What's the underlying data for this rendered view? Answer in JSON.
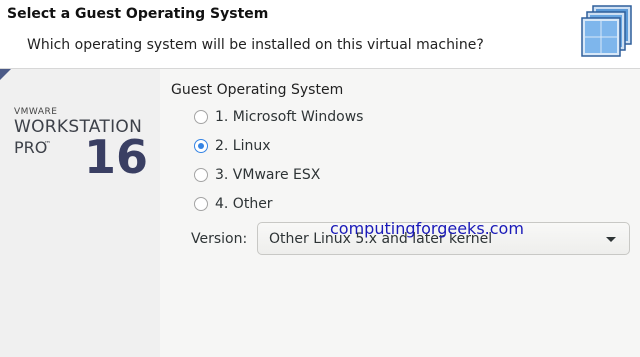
{
  "header": {
    "title": "Select a Guest Operating System",
    "subtitle": "Which operating system will be installed on this virtual machine?",
    "logo_icon": "vm-windows-icon"
  },
  "brand": {
    "vendor": "VMWARE",
    "product": "WORKSTATION",
    "edition": "PRO",
    "trademark": "™",
    "version": "16"
  },
  "guest_os": {
    "group_title": "Guest Operating System",
    "options": [
      {
        "label": "1. Microsoft Windows",
        "checked": false
      },
      {
        "label": "2. Linux",
        "checked": true
      },
      {
        "label": "3. VMware ESX",
        "checked": false
      },
      {
        "label": "4. Other",
        "checked": false
      }
    ],
    "version_label": "Version:",
    "version_value": "Other Linux 5.x and later kernel"
  },
  "watermark": "computingforgeeks.com",
  "colors": {
    "accent": "#3584e4",
    "brand_number": "#3a3f63",
    "watermark": "#1a1ab8"
  }
}
